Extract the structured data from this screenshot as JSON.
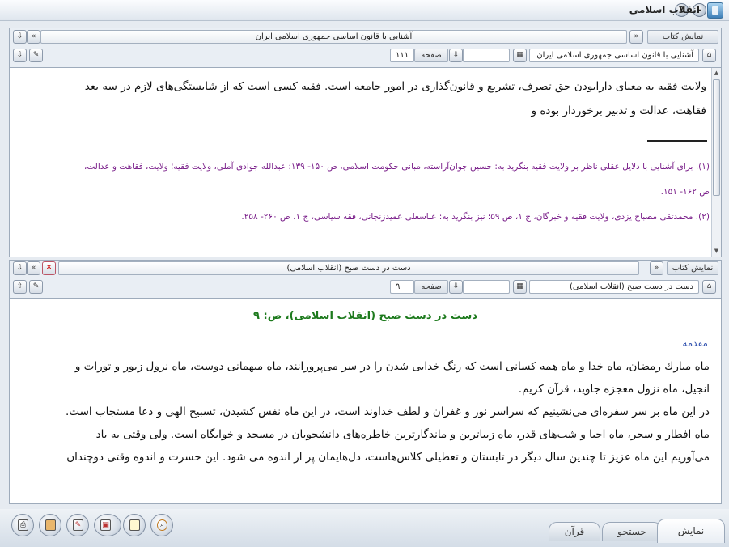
{
  "window": {
    "title": "انقلاب اسلامی"
  },
  "top_panel": {
    "show_book_label": "نمایش کتاب",
    "book_title": "آشنایی با قانون اساسی جمهوری اسلامی ایران",
    "page_label": "صفحه",
    "page_value": "۱۱۱",
    "book_combo": "آشنایی با قانون اساسی جمهوری اسلامی ایران",
    "body_lines": [
      "ولایت فقیه به معنای دارابودن حق تصرف، تشریع و قانون‌گذاری در امور جامعه است. فقیه کسی است که از  شایستگی‌های لازم در سه بعد",
      "فقاهت، عدالت و تدبیر برخوردار بوده و"
    ],
    "footnotes": [
      "(۱). برای آشنایی با دلایل عقلی ناظر بر ولایت فقیه بنگرید به: حسین جوان‌آراسته، مبانی حکومت اسلامی، ص ۱۵۰- ۱۳۹؛ عبدالله جوادی آملی، ولایت فقیه؛ ولایت، فقاهت و عدالت،",
      "ص ۱۶۲- ۱۵۱.",
      "(۲). محمدتقی مصباح یزدی، ولایت فقیه و خبرگان، ج ۱، ص ۵۹؛ نیز بنگرید به: عباسعلی عمیدزنجانی، فقه سیاسی، ج ۱، ص ۲۶۰- ۲۵۸."
    ]
  },
  "bottom_panel": {
    "show_book_label": "نمایش کتاب",
    "book_title": "دست در دست صبح (انقلاب اسلامی)",
    "page_label": "صفحه",
    "page_value": "۹",
    "book_combo": "(انقلاب اسلامی)",
    "book_field": "دست در دست صبح (انقلاب اسلامی)",
    "heading": "دست در دست صبح (انقلاب اسلامی)، ص: ۹",
    "section_title": "مقدمه",
    "body_lines": [
      "ماه مبارك رمضان، ماه خدا و ماه همه كسانی است كه رنگ خدایی  شدن را در سر می‌پرورانند، ماه میهمانی دوست، ماه نزول زبور و تورات و",
      "انجیل، ماه نزول معجزه جاوید، قرآن كریم.",
      "در این ماه بر سر سفره‌ای می‌نشینیم كه سراسر نور و غفران و لطف خداوند است، در این ماه نفس كشیدن، تسبیح الهی و دعا مستجاب است.",
      "ماه افطار و سحر، ماه احیا و  شب‌های قدر، ماه زیباترین و ماندگارترین خاطره‌های دانشجویان در مسجد و خوابگاه است. ولی وقتی به یاد",
      "می‌آوریم این ماه عزیز تا چندین سال دیگر در تابستان و تعطیلی كلاس‌هاست، دل‌هایمان پر از اندوه می شود. این حسرت و اندوه وقتی دوچندان"
    ]
  },
  "tabs": {
    "show": "نمایش",
    "search": "جستجو",
    "quran": "قرآن"
  }
}
